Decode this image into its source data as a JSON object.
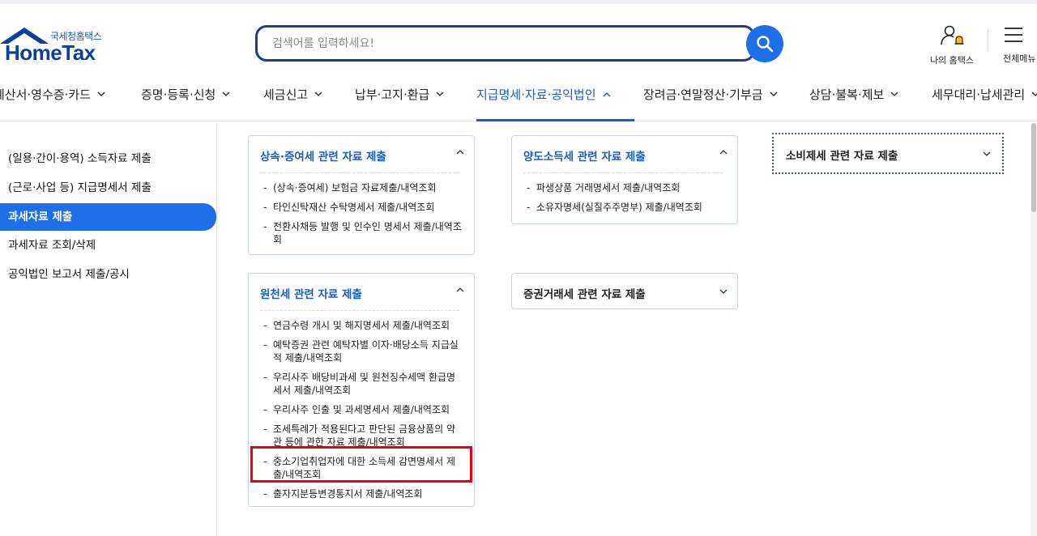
{
  "header": {
    "logo_sub": "국세청홈택스",
    "logo_main": "HomeTax",
    "search_placeholder": "검색어를 입력하세요!",
    "my_hometax": "나의 홈택스",
    "all_menu": "전체메뉴"
  },
  "nav": {
    "items": [
      {
        "label": "계산서·영수증·카드"
      },
      {
        "label": "증명·등록·신청"
      },
      {
        "label": "세금신고"
      },
      {
        "label": "납부·고지·환급"
      },
      {
        "label": "지급명세·자료·공익법인"
      },
      {
        "label": "장려금·연말정산·기부금"
      },
      {
        "label": "상담·불복·제보"
      },
      {
        "label": "세무대리·납세관리"
      }
    ],
    "active_index": 4
  },
  "sidebar": {
    "items": [
      {
        "label": "(일용·간이·용역) 소득자료 제출"
      },
      {
        "label": "(근로·사업 등) 지급명세서 제출"
      },
      {
        "label": "과세자료 제출"
      },
      {
        "label": "과세자료 조회/삭제"
      },
      {
        "label": "공익법인 보고서 제출/공시"
      }
    ],
    "active_index": 2
  },
  "cards": {
    "inheritance": {
      "title": "상속·증여세 관련 자료 제출",
      "items": [
        "(상속·증여세) 보험금 자료제출/내역조회",
        "타인신탁재산 수탁명세서 제출/내역조회",
        "전환사채등 발행 및 인수인 명세서 제출/내역조회"
      ]
    },
    "transfer": {
      "title": "양도소득세 관련 자료 제출",
      "items": [
        "파생상품 거래명세서 제출/내역조회",
        "소유자명세(실질주주명부) 제출/내역조회"
      ]
    },
    "consumption": {
      "title": "소비제세 관련 자료 제출"
    },
    "withholding": {
      "title": "원천세 관련 자료 제출",
      "items": [
        "연금수령 개시 및 해지명세서 제출/내역조회",
        "예탁증권 관련 예탁자별 이자·배당소득 지급실적 제출/내역조회",
        "우리사주 배당비과세 및 원천징수세액 환급명세서 제출/내역조회",
        "우리사주 인출 및 과세명세서 제출/내역조회",
        "조세특례가 적용된다고 판단된 금융상품의 약관 등에 관한 자료 제출/내역조회",
        "중소기업취업자에 대한 소득세 감면명세서 제출/내역조회",
        "출자지분등변경통지서 제출/내역조회"
      ]
    },
    "securities": {
      "title": "증권거래세 관련 자료 제출"
    }
  },
  "colors": {
    "primary": "#1f6fe8",
    "brand_dark": "#0e3f9a",
    "highlight": "#e60012"
  }
}
